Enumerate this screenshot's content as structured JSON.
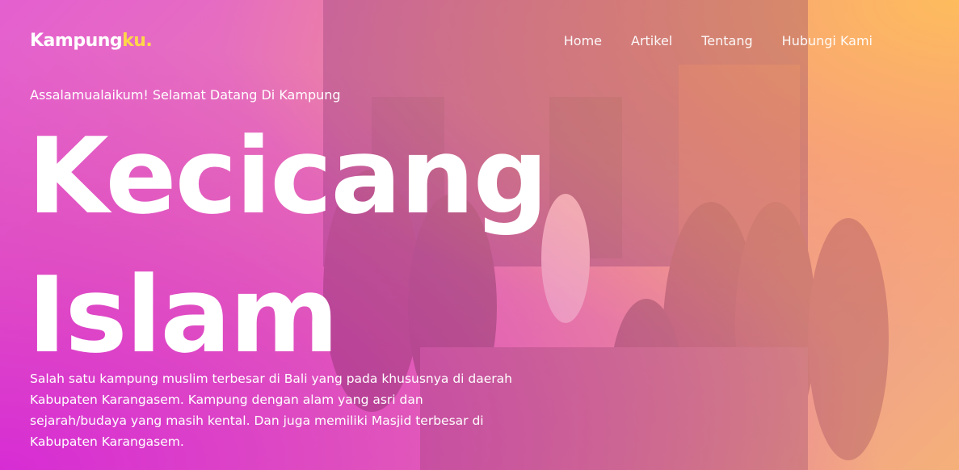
{
  "brand": {
    "name_main": "Kampung",
    "name_accent": "ku."
  },
  "nav": {
    "items": [
      {
        "label": "Home"
      },
      {
        "label": "Artikel"
      },
      {
        "label": "Tentang"
      },
      {
        "label": "Hubungi Kami"
      }
    ]
  },
  "hero": {
    "greeting": "Assalamualaikum! Selamat Datang Di Kampung",
    "title_line1": "Kecicang",
    "title_line2": "Islam",
    "description": "Salah satu kampung muslim terbesar di Bali yang pada khususnya di daerah Kabupaten Karangasem. Kampung dengan alam yang asri dan sejarah/budaya yang masih kental. Dan juga memiliki Masjid terbesar di Kabupaten Karangasem."
  },
  "colors": {
    "accent": "#ffd64a",
    "overlay_left": "#d628d6",
    "overlay_right": "#ffbe5a"
  }
}
